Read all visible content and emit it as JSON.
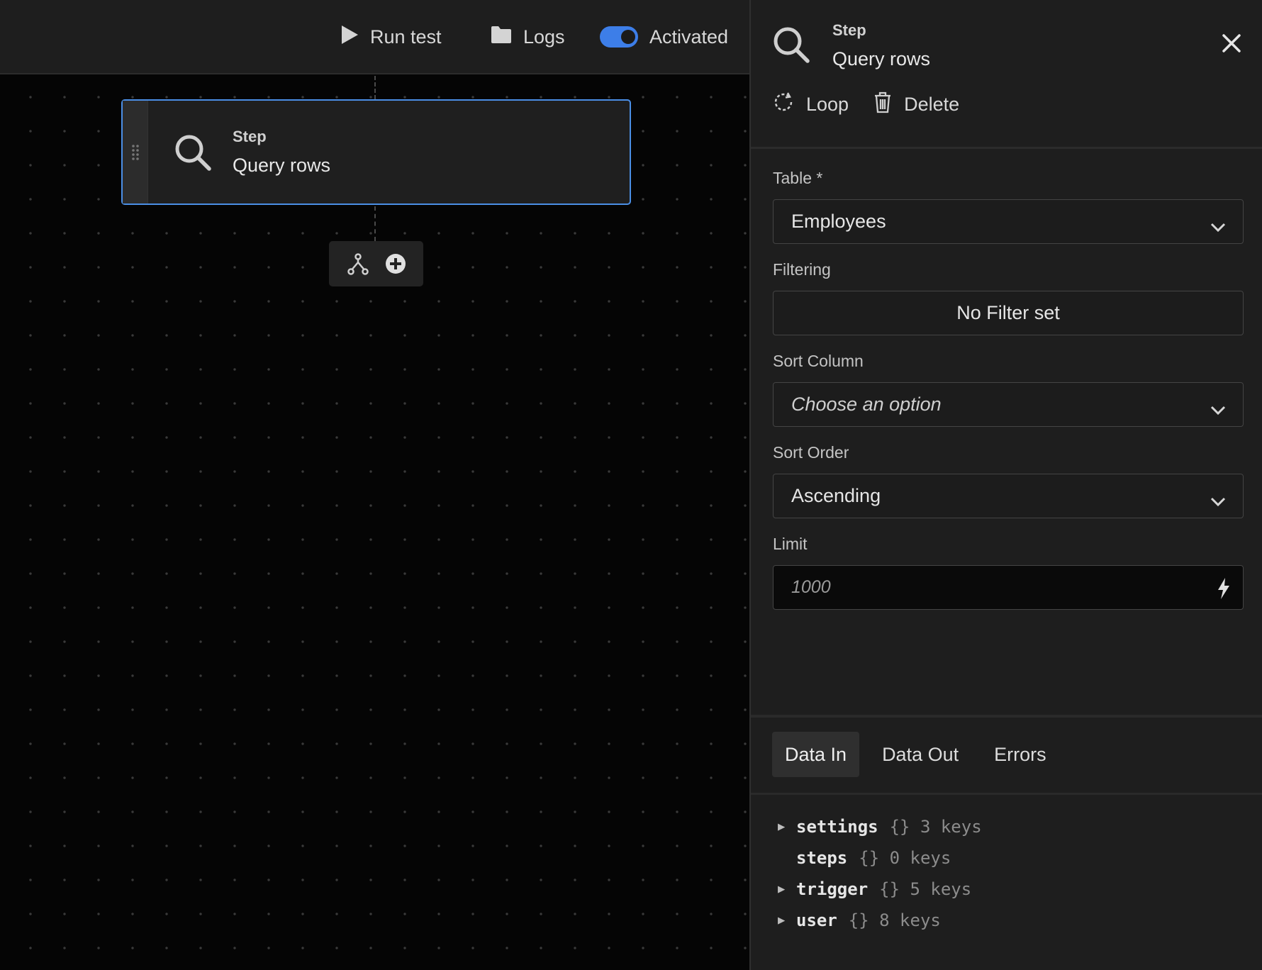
{
  "toolbar": {
    "run_test": "Run test",
    "logs": "Logs",
    "activated": "Activated"
  },
  "node": {
    "label": "Step",
    "title": "Query rows"
  },
  "panel": {
    "label": "Step",
    "title": "Query rows",
    "actions": {
      "loop": "Loop",
      "delete": "Delete"
    },
    "fields": {
      "table": {
        "label": "Table *",
        "value": "Employees"
      },
      "filtering": {
        "label": "Filtering",
        "value": "No Filter set"
      },
      "sort_column": {
        "label": "Sort Column",
        "value": "Choose an option"
      },
      "sort_order": {
        "label": "Sort Order",
        "value": "Ascending"
      },
      "limit": {
        "label": "Limit",
        "value": "1000"
      }
    },
    "tabs": [
      "Data In",
      "Data Out",
      "Errors"
    ],
    "active_tab": "Data In",
    "tree": [
      {
        "key": "settings",
        "meta": "{} 3 keys",
        "expandable": true
      },
      {
        "key": "steps",
        "meta": "{} 0 keys",
        "expandable": false
      },
      {
        "key": "trigger",
        "meta": "{} 5 keys",
        "expandable": true
      },
      {
        "key": "user",
        "meta": "{} 8 keys",
        "expandable": true
      }
    ]
  },
  "icons": {
    "run": "play-icon",
    "logs": "folder-icon",
    "search": "search-icon",
    "close": "close-icon",
    "loop": "loop-icon",
    "delete": "trash-icon",
    "branch": "branch-icon",
    "add": "plus-circle-icon",
    "chevron": "chevron-down-icon",
    "bolt": "bolt-icon",
    "drag": "drag-handle-icon"
  },
  "colors": {
    "accent": "#3d7ee8",
    "node_border": "#4b8fe6",
    "panel_bg": "#1e1e1e",
    "canvas_bg": "#050505"
  }
}
